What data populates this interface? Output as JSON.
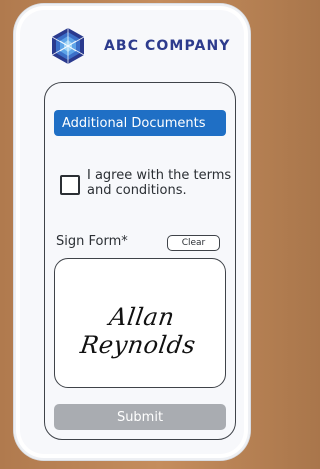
{
  "header": {
    "brand": "ABC COMPANY",
    "logo_icon": "hexagon-network-logo",
    "brand_color": "#2d3b8d"
  },
  "form": {
    "documents_button": "Additional Documents",
    "terms_label": "I agree with the terms and conditions.",
    "sign_label": "Sign Form*",
    "clear_button": "Clear",
    "signature": "Allan Reynolds",
    "submit_button": "Submit",
    "accent_color": "#1f6fc5",
    "disabled_color": "#a9acb1"
  }
}
